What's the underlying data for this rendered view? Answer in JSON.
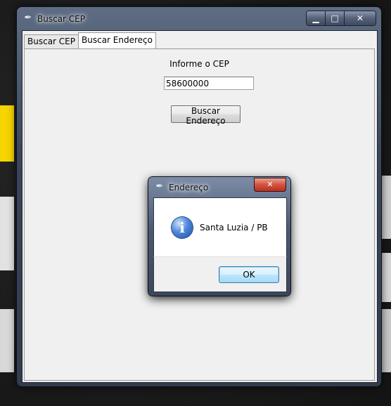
{
  "main_window": {
    "title": "Buscar CEP",
    "icon": "feather-icon",
    "caption_buttons": {
      "minimize": "minimize-icon",
      "maximize": "maximize-icon",
      "close": "close-icon"
    }
  },
  "tabs": [
    {
      "label": "Buscar CEP",
      "active": false
    },
    {
      "label": "Buscar Endereço",
      "active": true
    }
  ],
  "form": {
    "cep_label": "Informe o CEP",
    "cep_value": "58600000",
    "search_button": "Buscar Endereço"
  },
  "dialog": {
    "title": "Endereço",
    "icon": "information-icon",
    "message": "Santa Luzia / PB",
    "ok_label": "OK"
  },
  "colors": {
    "aero_frame": "#3a4558",
    "client_bg": "#f0f0f0",
    "ok_button": "#bee6fd",
    "close_button": "#d2533f"
  }
}
